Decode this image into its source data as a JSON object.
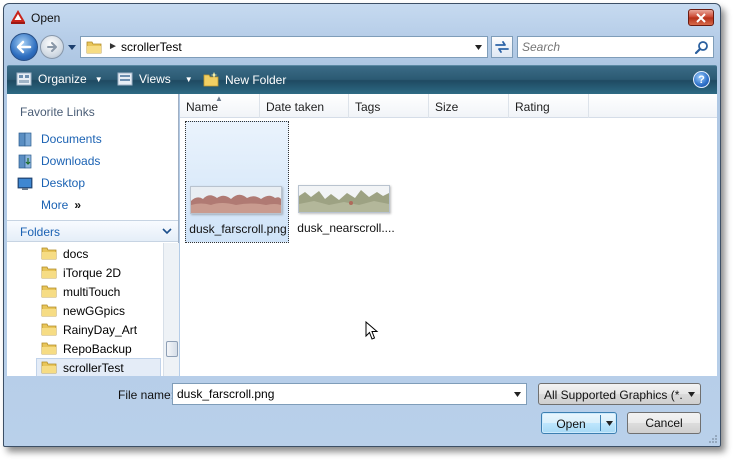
{
  "window": {
    "title": "Open",
    "accent_color": "#3b6b86",
    "close_icon": "close-icon",
    "app_icon": "autocad-logo-icon"
  },
  "address": {
    "current_folder": "scrollerTest",
    "refresh_icon": "refresh-icon"
  },
  "search": {
    "placeholder": "Search"
  },
  "toolbar": {
    "organize_label": "Organize",
    "views_label": "Views",
    "new_folder_label": "New Folder",
    "help_label": "?"
  },
  "sidebar": {
    "favorites_header": "Favorite Links",
    "favorites": [
      {
        "label": "Documents",
        "icon": "documents-icon"
      },
      {
        "label": "Downloads",
        "icon": "downloads-icon"
      },
      {
        "label": "Desktop",
        "icon": "desktop-icon"
      }
    ],
    "more_label": "More",
    "more_chevron": "»",
    "folders_header": "Folders",
    "folders": [
      {
        "label": "docs",
        "selected": false
      },
      {
        "label": "iTorque 2D",
        "selected": false
      },
      {
        "label": "multiTouch",
        "selected": false
      },
      {
        "label": "newGGpics",
        "selected": false
      },
      {
        "label": "RainyDay_Art",
        "selected": false
      },
      {
        "label": "RepoBackup",
        "selected": false
      },
      {
        "label": "scrollerTest",
        "selected": true
      }
    ]
  },
  "columns": {
    "name": "Name",
    "date_taken": "Date taken",
    "tags": "Tags",
    "size": "Size",
    "rating": "Rating"
  },
  "files": [
    {
      "name": "dusk_farscroll.png",
      "selected": true
    },
    {
      "name": "dusk_nearscroll....",
      "selected": false
    }
  ],
  "footer": {
    "filename_label": "File name:",
    "filename_value": "dusk_farscroll.png",
    "filetype_value": "All Supported Graphics (*.jpg;",
    "open_label": "Open",
    "cancel_label": "Cancel"
  }
}
